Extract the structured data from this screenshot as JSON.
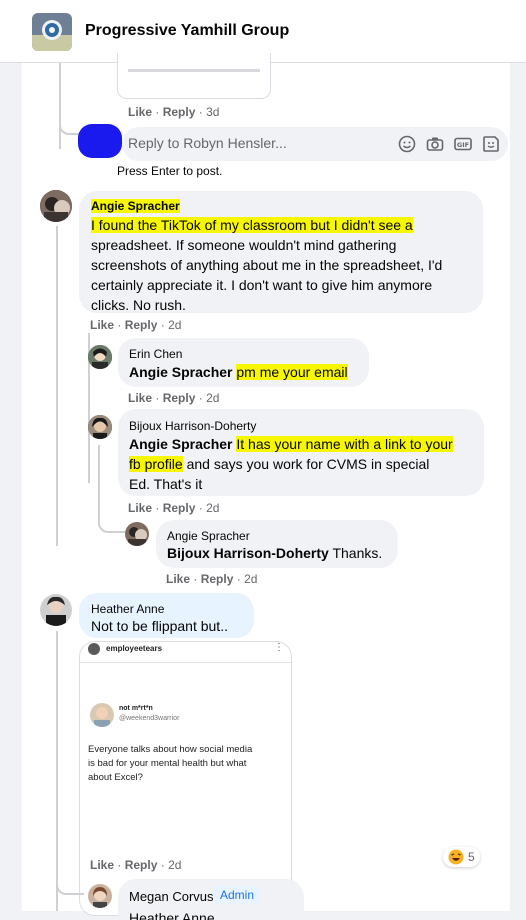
{
  "header": {
    "title": "Progressive Yamhill Group"
  },
  "reply_box": {
    "placeholder": "Reply to Robyn Hensler...",
    "hint": "Press Enter to post."
  },
  "actions": {
    "like": "Like",
    "dot": "·",
    "reply": "Reply"
  },
  "comments": [
    {
      "id": "c0",
      "time": "3d"
    },
    {
      "id": "c1",
      "author": "Angie Spracher",
      "text": "I found the TikTok of my classroom but I didn't see a spreadsheet. If someone wouldn't mind gathering screenshots of anything about me in the spreadsheet, I'd certainly appreciate it. I don't want to give him anymore clicks. No rush.",
      "lines": [
        "I found the TikTok of my classroom but I didn't see a",
        "spreadsheet. If someone wouldn't mind gathering",
        "screenshots of anything about me in the spreadsheet, I'd",
        "certainly appreciate it. I don't want to give him anymore",
        "clicks. No rush."
      ],
      "time": "2d"
    },
    {
      "id": "c2",
      "author": "Erin Chen",
      "tag": "Angie Spracher",
      "text": "pm me your email",
      "time": "2d"
    },
    {
      "id": "c3",
      "author": "Bijoux Harrison-Doherty",
      "tag": "Angie Spracher",
      "line1": "It has your name with a link to your",
      "line2a": "fb profile",
      "line2b": " and says you work for CVMS in special",
      "line3": "Ed. That's it",
      "time": "2d"
    },
    {
      "id": "c4",
      "author": "Angie Spracher",
      "tag": "Bijoux Harrison-Doherty",
      "text": "Thanks.",
      "time": "2d"
    },
    {
      "id": "c5",
      "author": "Heather Anne",
      "text": "Not to be flippant but..",
      "time": "2d",
      "reaction_count": "5"
    },
    {
      "id": "c6",
      "author": "Megan Corvus",
      "badge": "Admin",
      "partial": "Heather Anne"
    }
  ],
  "embedded_post": {
    "account": "employeetears",
    "user": "not m*rt*n",
    "handle": "@weekend3warrior",
    "body": [
      "Everyone talks about how social media",
      "is bad for your mental health but what",
      "about Excel?"
    ]
  },
  "icons": [
    "group-icon",
    "emoji-icon",
    "camera-icon",
    "gif-icon",
    "sticker-icon",
    "more-icon",
    "laugh-reaction-icon"
  ],
  "colors": {
    "highlight": "#f7f700",
    "admin_badge": "#1b74e4",
    "bubble": "#f0f2f5",
    "meta": "#65676b"
  }
}
